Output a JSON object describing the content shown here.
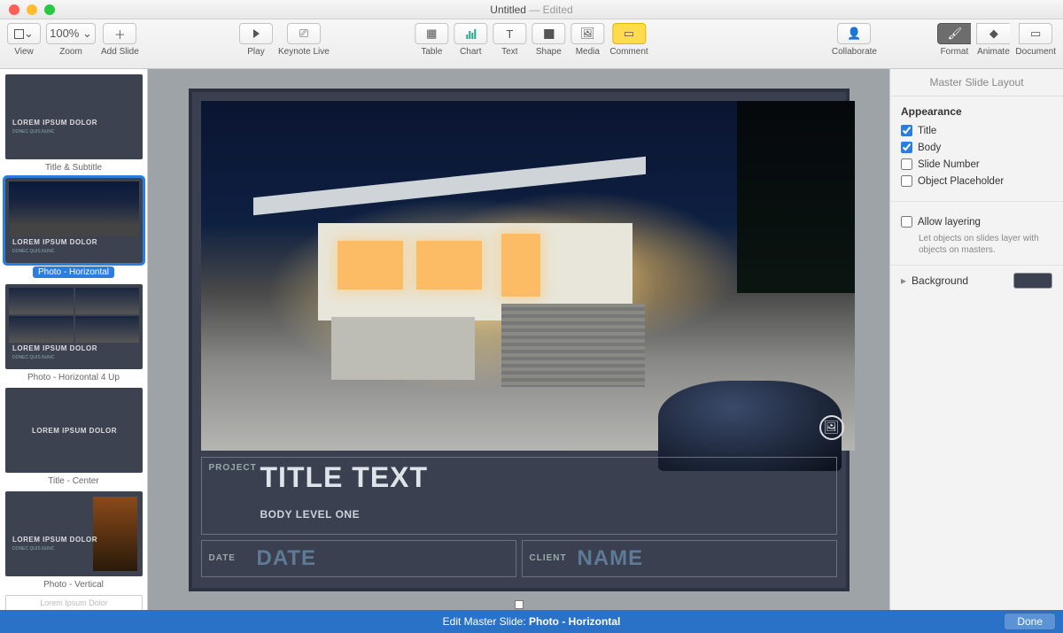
{
  "window": {
    "title": "Untitled",
    "status": "— Edited"
  },
  "toolbar": {
    "view": "View",
    "zoom": "Zoom",
    "zoom_value": "100% ⌄",
    "addslide": "Add Slide",
    "play": "Play",
    "keynotelive": "Keynote Live",
    "table": "Table",
    "chart": "Chart",
    "text": "Text",
    "shape": "Shape",
    "media": "Media",
    "comment": "Comment",
    "collaborate": "Collaborate",
    "format": "Format",
    "animate": "Animate",
    "document": "Document"
  },
  "thumbs": [
    {
      "caption": "Title & Subtitle",
      "t1": "LOREM IPSUM DOLOR",
      "t2": "DONEC QUIS NUNC"
    },
    {
      "caption": "Photo - Horizontal",
      "t1": "LOREM IPSUM DOLOR",
      "t2": "DONEC QUIS NUNC",
      "active": true
    },
    {
      "caption": "Photo - Horizontal 4 Up",
      "t1": "LOREM IPSUM DOLOR",
      "t2": "DONEC QUIS NUNC"
    },
    {
      "caption": "Title - Center",
      "t1": "LOREM IPSUM DOLOR"
    },
    {
      "caption": "Photo - Vertical",
      "t1": "LOREM IPSUM DOLOR",
      "t2": "DONEC QUIS NUNC"
    },
    {
      "caption": "",
      "t1": "Lorem Ipsum Dolor"
    }
  ],
  "slide": {
    "project_label": "PROJECT",
    "title": "TITLE TEXT",
    "body": "BODY LEVEL ONE",
    "date_label": "DATE",
    "date_value": "DATE",
    "client_label": "CLIENT",
    "client_value": "NAME"
  },
  "inspector": {
    "panel_title": "Master Slide Layout",
    "appearance": "Appearance",
    "title_chk": "Title",
    "body_chk": "Body",
    "slidenum_chk": "Slide Number",
    "objph_chk": "Object Placeholder",
    "layering_chk": "Allow layering",
    "layering_hint": "Let objects on slides layer with objects on masters.",
    "background": "Background"
  },
  "footer": {
    "prefix": "Edit Master Slide: ",
    "name": "Photo - Horizontal",
    "done": "Done"
  }
}
